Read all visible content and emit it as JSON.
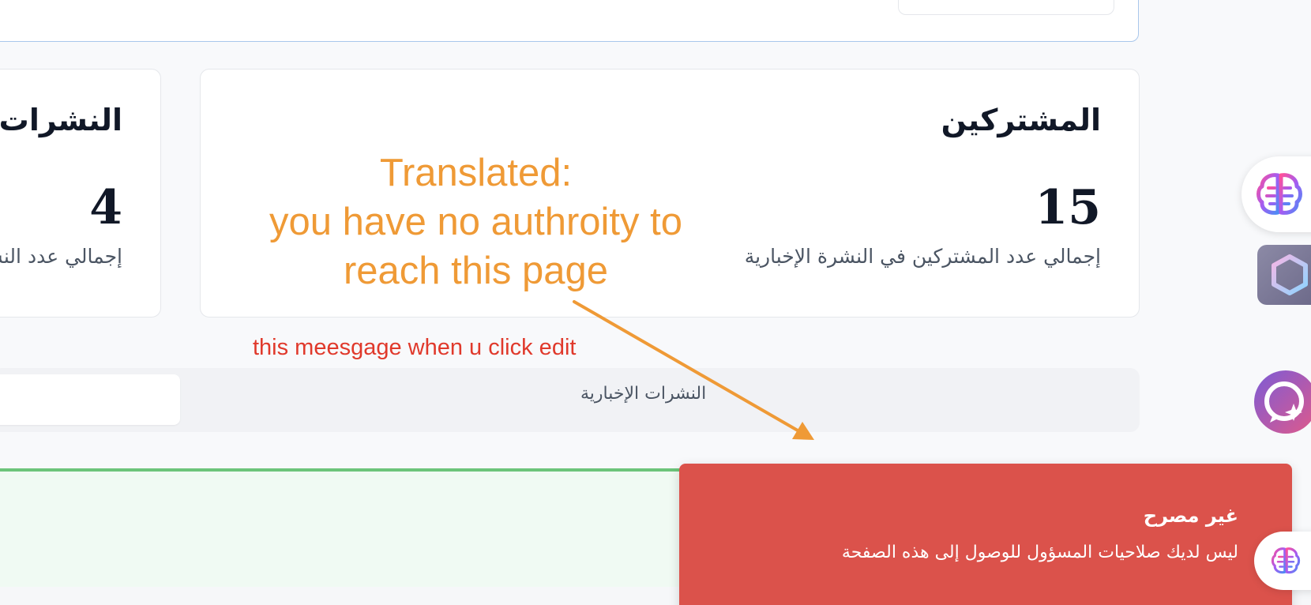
{
  "subscribers_card": {
    "title": "المشتركين",
    "value": "15",
    "description": "إجمالي عدد المشتركين في النشرة الإخبارية"
  },
  "newsletters_card": {
    "title": "النشرات الإ",
    "value": "4",
    "description": "إجمالي عدد النشرات"
  },
  "tabs": {
    "active_label": "النشرات الإخبارية"
  },
  "toast": {
    "title": "غير مصرح",
    "message": "ليس لديك صلاحيات المسؤول للوصول إلى هذه الصفحة"
  },
  "annotations": {
    "translated": [
      "Translated:",
      "you have no authroity to",
      "reach this page"
    ],
    "note": "this meesgage when u click edit"
  },
  "colors": {
    "toast_bg": "#db524b",
    "annotation_orange": "#ef9a36",
    "annotation_red": "#e0392b",
    "success_green": "#6cc47a"
  },
  "icons": {
    "brain": "brain-icon",
    "hexagon": "hexagon-icon",
    "chat_sparkle": "chat-sparkle-icon"
  }
}
